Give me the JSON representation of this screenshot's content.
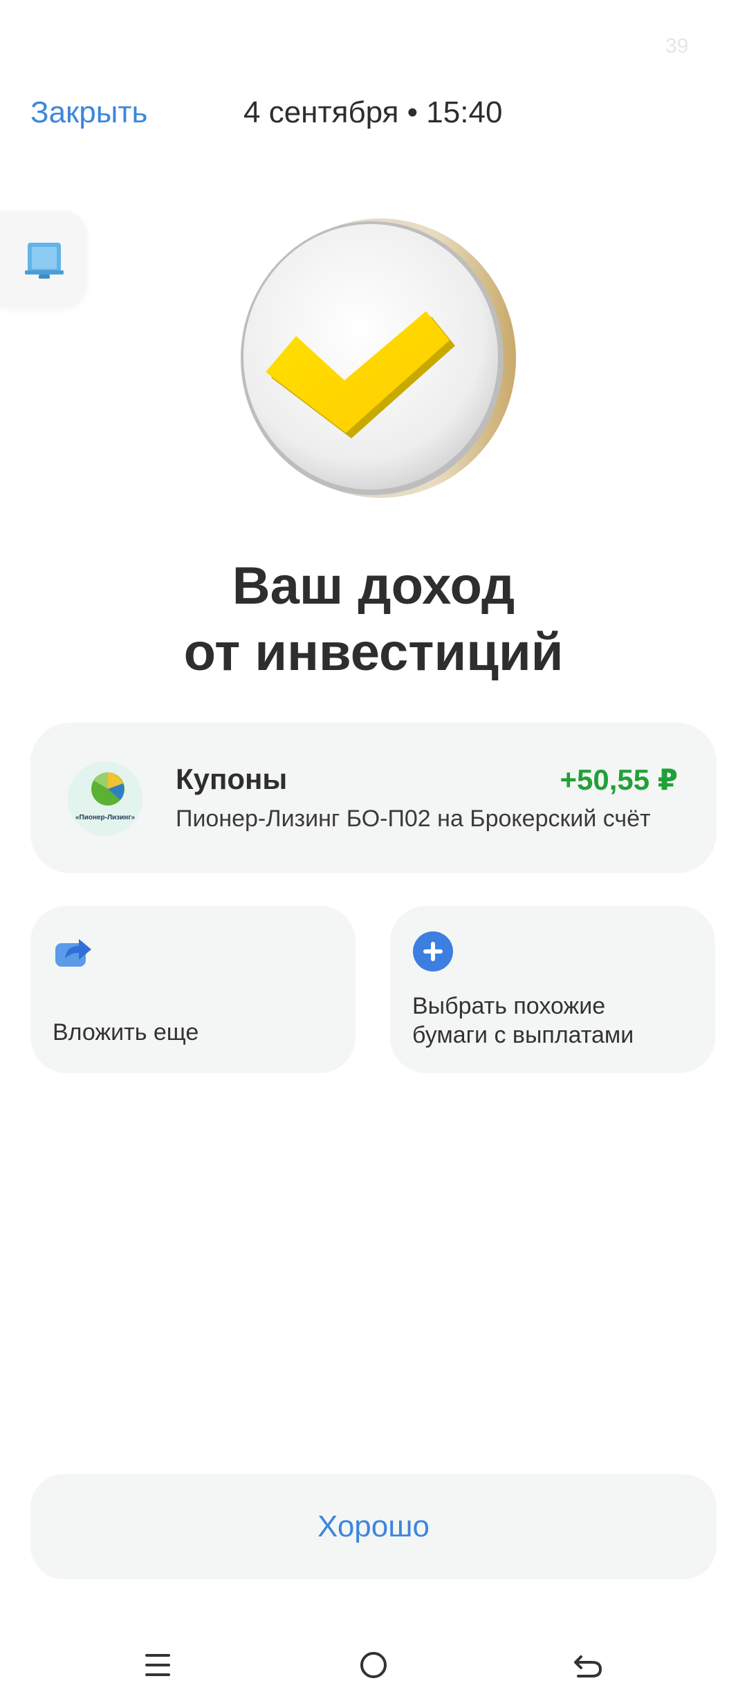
{
  "status_bar": {
    "number": "39"
  },
  "header": {
    "close_label": "Закрыть",
    "datetime": "4 сентября • 15:40"
  },
  "hero": {
    "title_line1": "Ваш доход",
    "title_line2": "от инвестиций",
    "icon": "yellow-checkmark-icon"
  },
  "coupon": {
    "logo_text": "«Пионер-Лизинг»",
    "title": "Купоны",
    "amount": "+50,55 ₽",
    "description": "Пионер-Лизинг БО-П02 на Брокерский счёт",
    "amount_color": "#21a038"
  },
  "actions": [
    {
      "label": "Вложить еще",
      "icon": "share-arrow-icon"
    },
    {
      "label_line1": "Выбрать похожие",
      "label_line2": "бумаги с выплатами",
      "icon": "plus-circle-icon"
    }
  ],
  "ok_button": {
    "label": "Хорошо"
  },
  "nav_bar": {
    "icons": [
      "menu-icon",
      "home-icon",
      "back-icon"
    ]
  },
  "colors": {
    "accent": "#3d86dc",
    "positive": "#21a038",
    "card_bg": "#f4f6f5",
    "check_yellow": "#ffd600"
  }
}
